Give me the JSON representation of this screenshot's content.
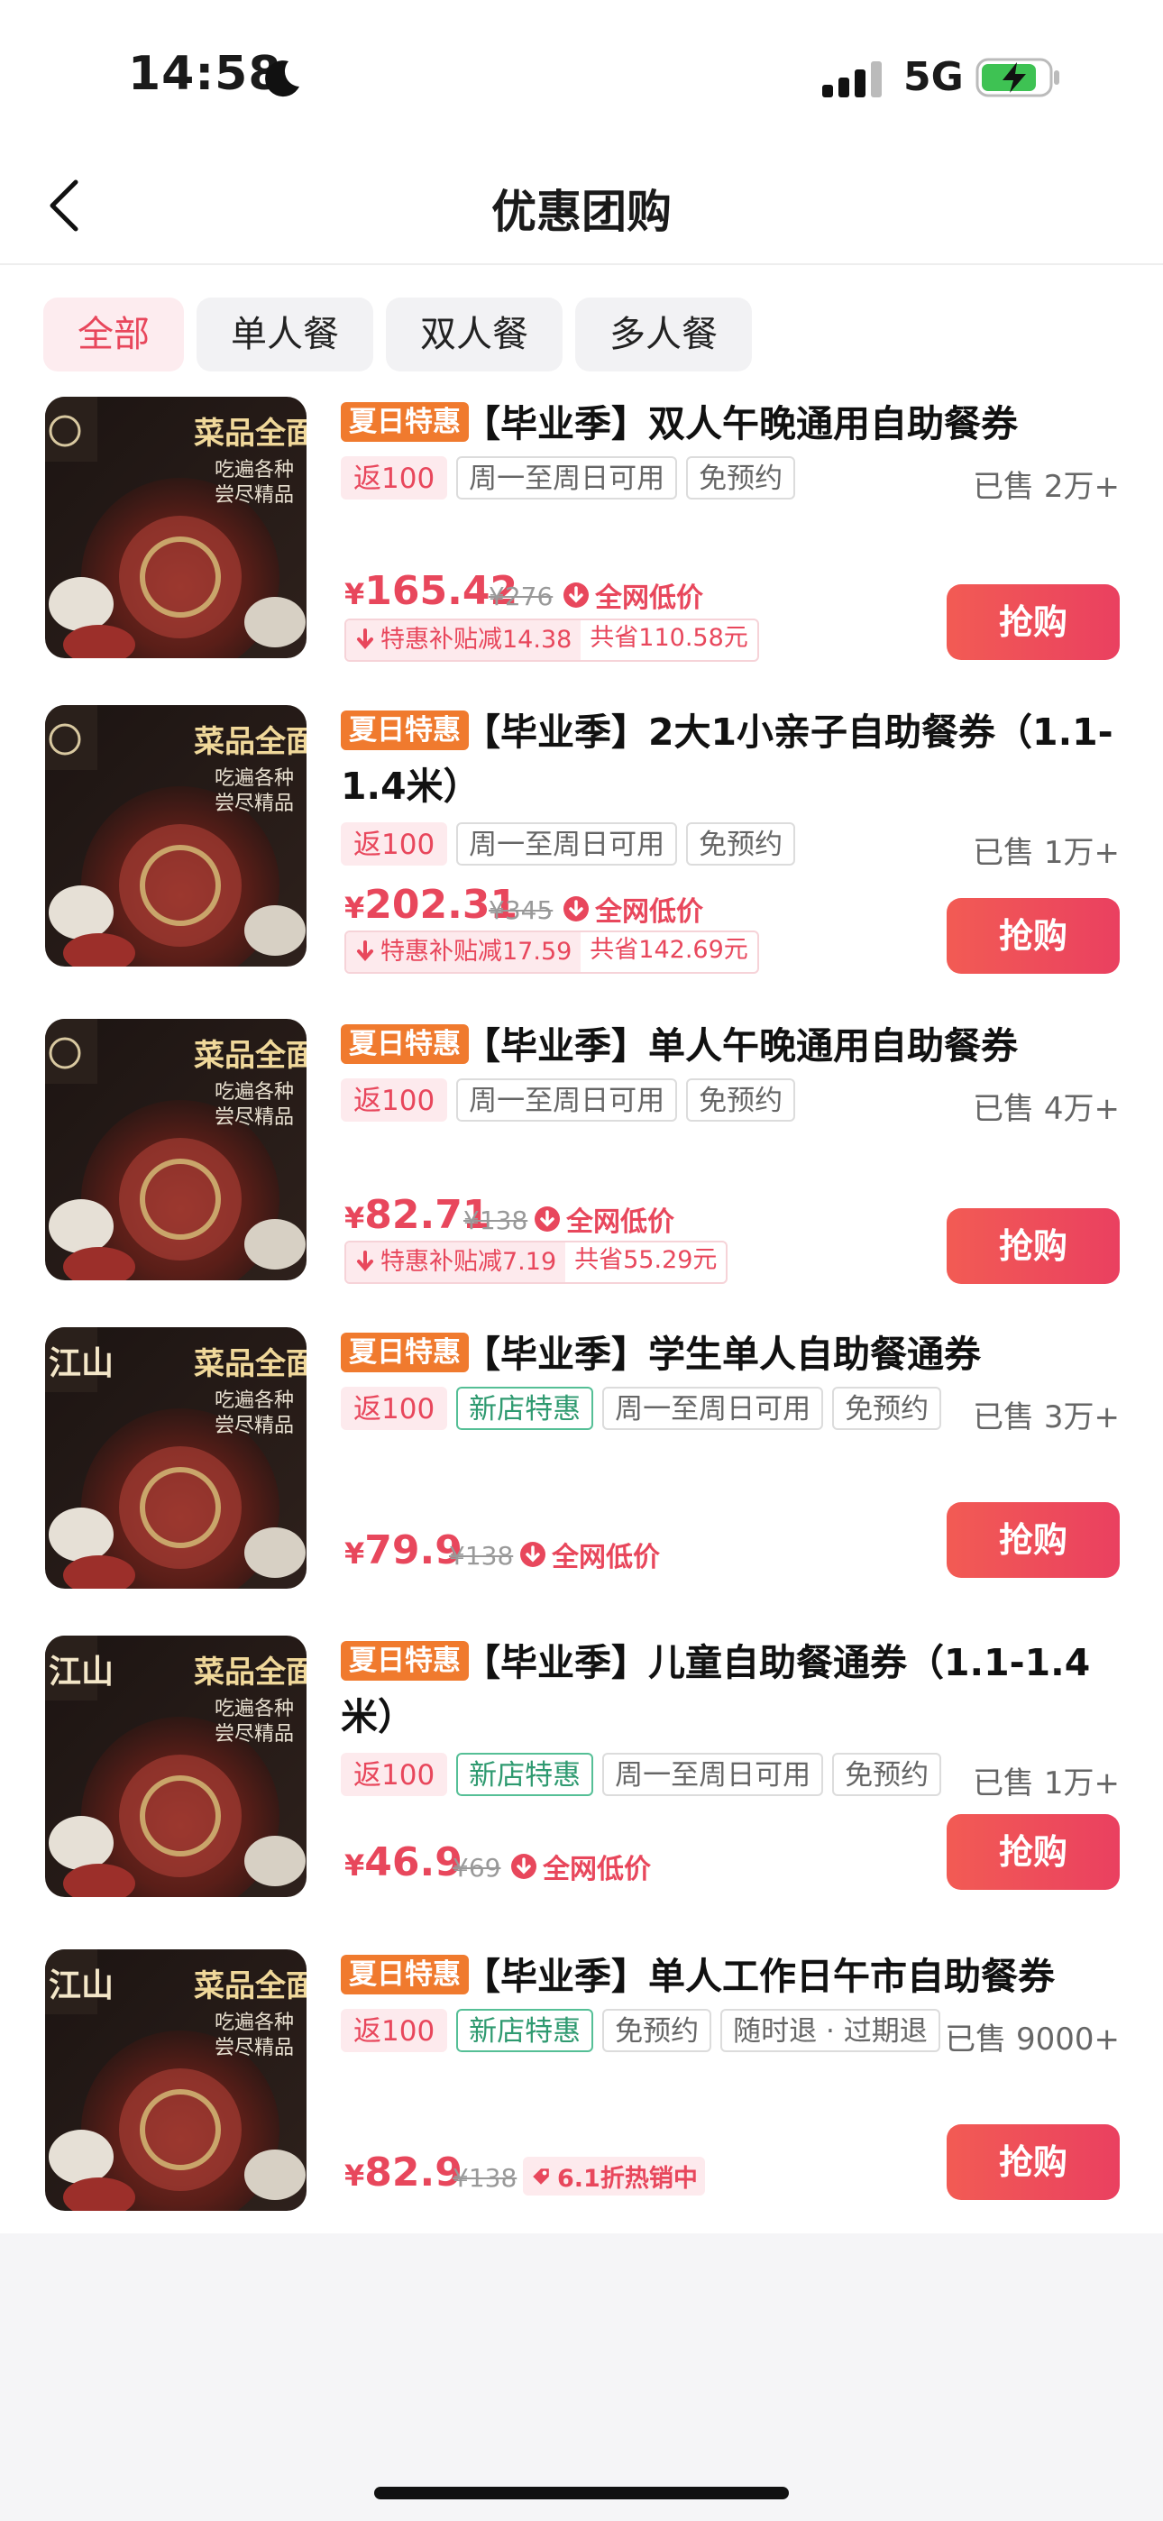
{
  "status": {
    "time": "14:58",
    "network": "5G"
  },
  "nav": {
    "title": "优惠团购"
  },
  "tabs": [
    "全部",
    "单人餐",
    "双人餐",
    "多人餐"
  ],
  "colors": {
    "accent": "#e8475c",
    "badge": "#f07a2e",
    "green": "#2f9a70"
  },
  "thumb_text": {
    "brand": "江山",
    "headline": "菜品全面升",
    "line1": "吃遍各种",
    "line2": "尝尽精品"
  },
  "products": [
    {
      "badge": "夏日特惠",
      "title": "【毕业季】双人午晚通用自助餐券",
      "tags": [
        "返100",
        "周一至周日可用",
        "免预约"
      ],
      "sold": "已售 2万+",
      "price_currency": "¥",
      "price": "165.42",
      "original": "¥276",
      "low_label": "全网低价",
      "subsidy": "特惠补贴减14.38",
      "saved": "共省110.58元",
      "buy": "抢购"
    },
    {
      "badge": "夏日特惠",
      "title": "【毕业季】2大1小亲子自助餐券（1.1-1.4米）",
      "tags": [
        "返100",
        "周一至周日可用",
        "免预约"
      ],
      "sold": "已售 1万+",
      "price_currency": "¥",
      "price": "202.31",
      "original": "¥345",
      "low_label": "全网低价",
      "subsidy": "特惠补贴减17.59",
      "saved": "共省142.69元",
      "buy": "抢购"
    },
    {
      "badge": "夏日特惠",
      "title": "【毕业季】单人午晚通用自助餐券",
      "tags": [
        "返100",
        "周一至周日可用",
        "免预约"
      ],
      "sold": "已售 4万+",
      "price_currency": "¥",
      "price": "82.71",
      "original": "¥138",
      "low_label": "全网低价",
      "subsidy": "特惠补贴减7.19",
      "saved": "共省55.29元",
      "buy": "抢购"
    },
    {
      "badge": "夏日特惠",
      "title": "【毕业季】学生单人自助餐通券",
      "tags": [
        "返100",
        "新店特惠",
        "周一至周日可用",
        "免预约"
      ],
      "sold": "已售 3万+",
      "price_currency": "¥",
      "price": "79.9",
      "original": "¥138",
      "low_label": "全网低价",
      "buy": "抢购"
    },
    {
      "badge": "夏日特惠",
      "title": "【毕业季】儿童自助餐通券（1.1-1.4米）",
      "tags": [
        "返100",
        "新店特惠",
        "周一至周日可用",
        "免预约"
      ],
      "sold": "已售 1万+",
      "price_currency": "¥",
      "price": "46.9",
      "original": "¥69",
      "low_label": "全网低价",
      "buy": "抢购"
    },
    {
      "badge": "夏日特惠",
      "title": "【毕业季】单人工作日午市自助餐券",
      "tags": [
        "返100",
        "新店特惠",
        "免预约",
        "随时退 · 过期退"
      ],
      "sold": "已售 9000+",
      "price_currency": "¥",
      "price": "82.9",
      "original": "¥138",
      "low_label": "6.1折热销中",
      "buy": "抢购"
    }
  ]
}
